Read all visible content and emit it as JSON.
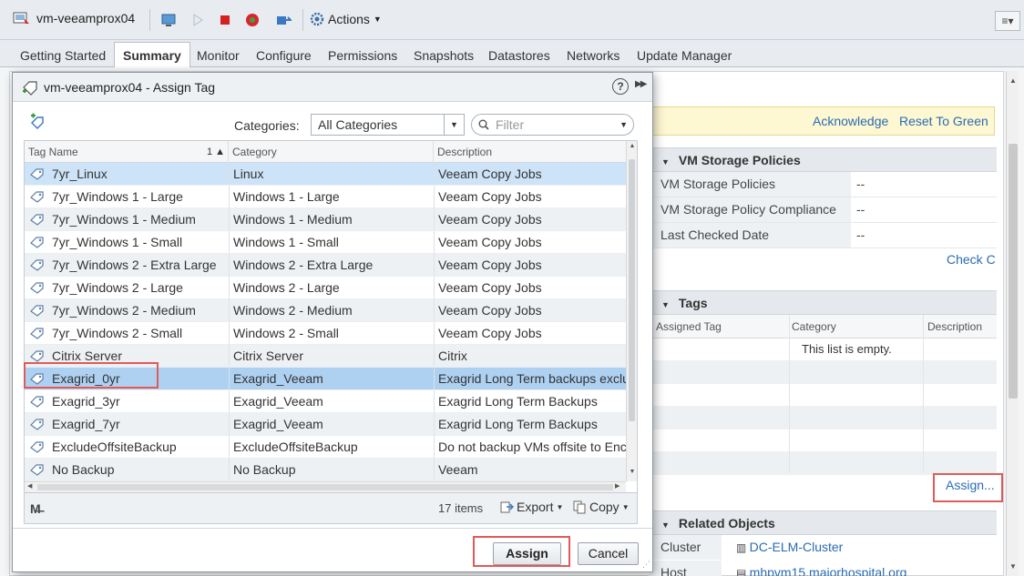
{
  "header": {
    "vm_name": "vm-veeamprox04",
    "actions_label": "Actions"
  },
  "tabs": [
    {
      "label": "Getting Started"
    },
    {
      "label": "Summary"
    },
    {
      "label": "Monitor"
    },
    {
      "label": "Configure"
    },
    {
      "label": "Permissions"
    },
    {
      "label": "Snapshots"
    },
    {
      "label": "Datastores"
    },
    {
      "label": "Networks"
    },
    {
      "label": "Update Manager"
    }
  ],
  "background": {
    "alert": {
      "acknowledge": "Acknowledge",
      "reset": "Reset To Green"
    },
    "storage_policies": {
      "title": "VM Storage Policies",
      "rows": [
        {
          "k": "VM Storage Policies",
          "v": "--"
        },
        {
          "k": "VM Storage Policy Compliance",
          "v": "--"
        },
        {
          "k": "Last Checked Date",
          "v": "--"
        }
      ],
      "check_link": "Check C"
    },
    "tags": {
      "title": "Tags",
      "columns": [
        "Assigned Tag",
        "Category",
        "Description"
      ],
      "empty_text": "This list is empty.",
      "assign_link": "Assign..."
    },
    "related": {
      "title": "Related Objects",
      "rows": [
        {
          "k": "Cluster",
          "v": "DC-ELM-Cluster"
        },
        {
          "k": "Host",
          "v": "mhpvm15.majorhospital.org"
        }
      ]
    }
  },
  "dialog": {
    "title": "vm-veeamprox04 - Assign Tag",
    "categories_label": "Categories:",
    "category_value": "All Categories",
    "filter_placeholder": "Filter",
    "columns": {
      "name": "Tag Name",
      "sort_indicator": "1 ▲",
      "category": "Category",
      "description": "Description"
    },
    "rows": [
      {
        "name": "7yr_Linux",
        "category": "Linux",
        "description": "Veeam Copy Jobs"
      },
      {
        "name": "7yr_Windows 1 - Large",
        "category": "Windows 1 - Large",
        "description": "Veeam Copy Jobs"
      },
      {
        "name": "7yr_Windows 1 - Medium",
        "category": "Windows 1 - Medium",
        "description": "Veeam Copy Jobs"
      },
      {
        "name": "7yr_Windows 1 - Small",
        "category": "Windows 1 - Small",
        "description": "Veeam Copy Jobs"
      },
      {
        "name": "7yr_Windows 2 - Extra Large",
        "category": "Windows 2 - Extra Large",
        "description": "Veeam Copy Jobs"
      },
      {
        "name": "7yr_Windows 2 - Large",
        "category": "Windows 2 - Large",
        "description": "Veeam Copy Jobs"
      },
      {
        "name": "7yr_Windows 2 - Medium",
        "category": "Windows 2 - Medium",
        "description": "Veeam Copy Jobs"
      },
      {
        "name": "7yr_Windows 2 - Small",
        "category": "Windows 2 - Small",
        "description": "Veeam Copy Jobs"
      },
      {
        "name": "Citrix Server",
        "category": "Citrix Server",
        "description": "Citrix"
      },
      {
        "name": "Exagrid_0yr",
        "category": "Exagrid_Veeam",
        "description": "Exagrid Long Term backups exclu"
      },
      {
        "name": "Exagrid_3yr",
        "category": "Exagrid_Veeam",
        "description": "Exagrid Long Term Backups"
      },
      {
        "name": "Exagrid_7yr",
        "category": "Exagrid_Veeam",
        "description": "Exagrid Long Term Backups"
      },
      {
        "name": "ExcludeOffsiteBackup",
        "category": "ExcludeOffsiteBackup",
        "description": "Do not backup VMs offsite to Enc"
      },
      {
        "name": "No Backup",
        "category": "No Backup",
        "description": "Veeam"
      }
    ],
    "items_count": "17 items",
    "export_label": "Export",
    "copy_label": "Copy",
    "assign_button": "Assign",
    "cancel_button": "Cancel"
  },
  "colors": {
    "highlight_box": "#e15a5a",
    "link": "#2a6cb2",
    "selected_row": "#aed1f2"
  }
}
